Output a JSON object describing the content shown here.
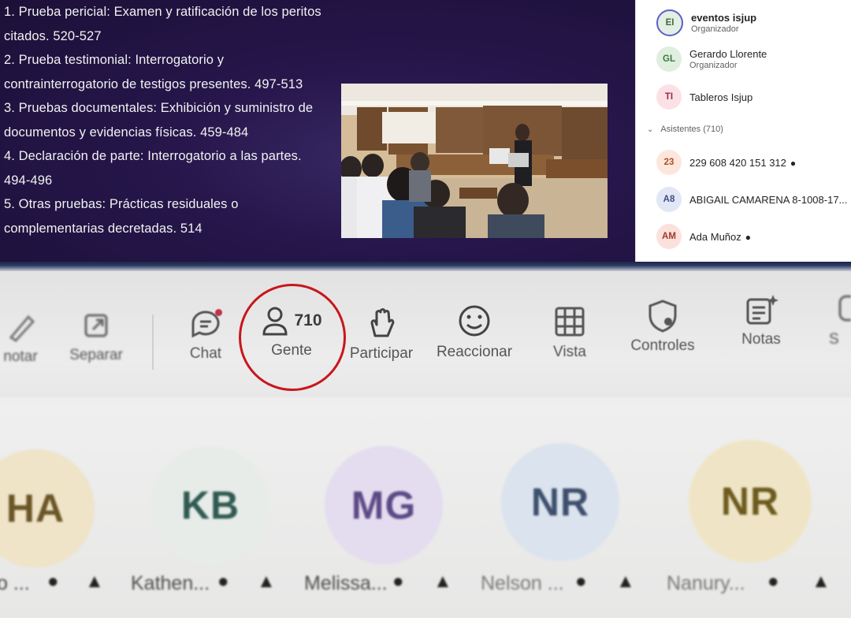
{
  "slide": {
    "lines": [
      "1. Prueba pericial: Examen y ratificación de los peritos",
      "citados. 520-527",
      "2. Prueba testimonial: Interrogatorio y",
      "contrainterrogatorio de testigos presentes. 497-513",
      "3. Pruebas documentales: Exhibición y suministro de",
      "documentos y evidencias físicas. 459-484",
      "4. Declaración de parte: Interrogatorio a las partes.",
      "494-496",
      "5. Otras pruebas: Prácticas residuales o",
      "complementarias decretadas. 514"
    ]
  },
  "panel": {
    "organizers": [
      {
        "initials": "EI",
        "name": "eventos isjup",
        "role": "Organizador",
        "bg": "#e4efe3",
        "fg": "#3b6e3a"
      },
      {
        "initials": "GL",
        "name": "Gerardo Llorente",
        "role": "Organizador",
        "bg": "#dfeede",
        "fg": "#3f7a44"
      },
      {
        "initials": "TI",
        "name": "Tableros Isjup",
        "role": "",
        "bg": "#fbe1e6",
        "fg": "#9a2a48"
      }
    ],
    "attendees_header": "Asistentes (710)",
    "attendees": [
      {
        "initials": "23",
        "name": "229 608 420 151 312",
        "bg": "#fde7dd",
        "fg": "#b24a25"
      },
      {
        "initials": "A8",
        "name": "ABIGAIL CAMARENA 8-1008-17...",
        "bg": "#e1e7f4",
        "fg": "#3c4f82"
      },
      {
        "initials": "AM",
        "name": "Ada Muñoz",
        "bg": "#fbe1dc",
        "fg": "#9e3a2c"
      }
    ]
  },
  "toolbar": {
    "anotar": "notar",
    "separar": "Separar",
    "chat": "Chat",
    "people_count": "710",
    "people": "Gente",
    "participar": "Participar",
    "reaccionar": "Reaccionar",
    "vista": "Vista",
    "controles": "Controles",
    "notas": "Notas",
    "more": "S"
  },
  "tiles": [
    {
      "initials": "HA",
      "name": "o ...",
      "bg": "#efe3c8",
      "fg": "#6a5526"
    },
    {
      "initials": "KB",
      "name": "Kathen...",
      "bg": "#e7ece8",
      "fg": "#2f5a52"
    },
    {
      "initials": "MG",
      "name": "Melissa...",
      "bg": "#e4dcef",
      "fg": "#5b4a86"
    },
    {
      "initials": "NR",
      "name": "Nelson ...",
      "bg": "#dbe3ee",
      "fg": "#3d4f6c"
    },
    {
      "initials": "NR",
      "name": "Nanury...",
      "bg": "#efe5c6",
      "fg": "#6d5b1e"
    }
  ]
}
